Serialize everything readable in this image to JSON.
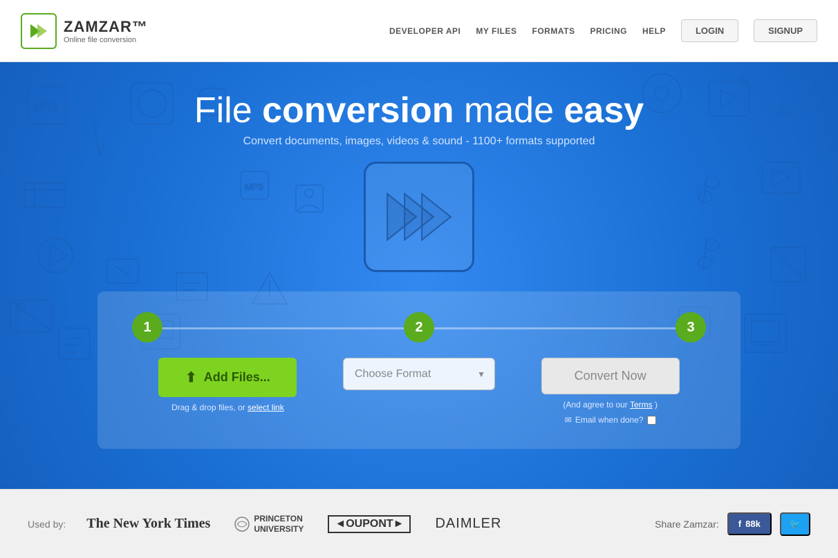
{
  "header": {
    "logo_name": "ZAMZAR™",
    "logo_tagline": "Online file conversion",
    "nav_links": [
      {
        "label": "DEVELOPER API",
        "key": "developer-api"
      },
      {
        "label": "MY FILES",
        "key": "my-files"
      },
      {
        "label": "FORMATS",
        "key": "formats"
      },
      {
        "label": "PRICING",
        "key": "pricing"
      },
      {
        "label": "HELP",
        "key": "help"
      }
    ],
    "login_label": "LOGIN",
    "signup_label": "SIGNUP"
  },
  "hero": {
    "title_part1": "File ",
    "title_bold": "conversion",
    "title_part2": " made ",
    "title_bold2": "easy",
    "subtitle": "Convert documents, images, videos & sound - 1100+ formats supported"
  },
  "steps": {
    "step1_number": "1",
    "step2_number": "2",
    "step3_number": "3",
    "add_files_label": "Add Files...",
    "drag_drop_text": "Drag & drop files, or",
    "select_link_label": "select link",
    "choose_format_placeholder": "Choose Format",
    "choose_format_arrow": "▼",
    "convert_now_label": "Convert Now",
    "terms_text": "(And agree to our",
    "terms_link": "Terms",
    "terms_close": ")",
    "email_label": "Email when done?"
  },
  "footer": {
    "used_by_label": "Used by:",
    "brands": [
      {
        "label": "The New York Times",
        "type": "nyt"
      },
      {
        "label": "PRINCETON UNIVERSITY",
        "type": "princeton"
      },
      {
        "label": "◄OUPONT►",
        "type": "dupont"
      },
      {
        "label": "DAIMLER",
        "type": "daimler"
      }
    ],
    "share_label": "Share Zamzar:",
    "facebook_label": "f  88k",
    "twitter_icon": "🐦"
  }
}
